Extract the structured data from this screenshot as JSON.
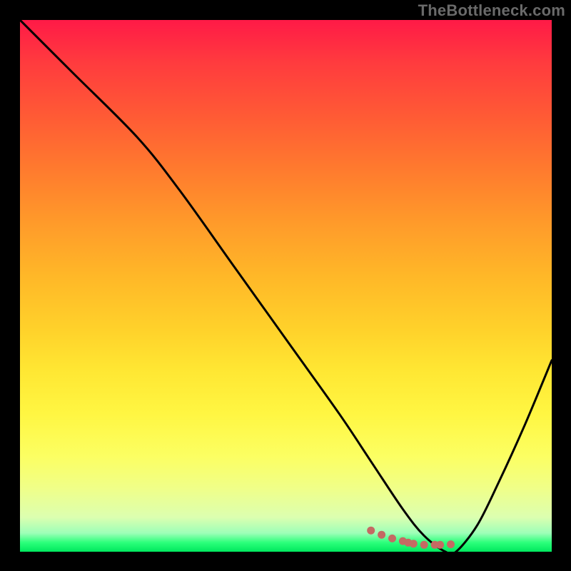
{
  "watermark": "TheBottleneck.com",
  "colors": {
    "curve_stroke": "#000000",
    "dotted_stroke": "#c46a63",
    "background": "#000000"
  },
  "chart_data": {
    "type": "line",
    "title": "",
    "xlabel": "",
    "ylabel": "",
    "xlim": [
      0,
      100
    ],
    "ylim": [
      0,
      100
    ],
    "series": [
      {
        "name": "bottleneck-curve",
        "x": [
          0,
          10,
          22,
          30,
          40,
          50,
          60,
          66,
          72,
          76,
          80,
          82,
          86,
          90,
          95,
          100
        ],
        "values": [
          100,
          90,
          78,
          68,
          54,
          40,
          26,
          17,
          8,
          3,
          0,
          0,
          5,
          13,
          24,
          36
        ]
      }
    ],
    "dotted_segment": {
      "name": "highlight-dots",
      "x": [
        66,
        68,
        70,
        72,
        73,
        74,
        76,
        78,
        79,
        81
      ],
      "values": [
        4,
        3.2,
        2.5,
        2.0,
        1.7,
        1.5,
        1.3,
        1.3,
        1.3,
        1.4
      ]
    },
    "gradient_stops": [
      {
        "pct": 0,
        "color": "#ff1a47"
      },
      {
        "pct": 18,
        "color": "#ff5a35"
      },
      {
        "pct": 38,
        "color": "#ff9a2a"
      },
      {
        "pct": 58,
        "color": "#ffd12a"
      },
      {
        "pct": 74,
        "color": "#fff642"
      },
      {
        "pct": 88,
        "color": "#f0ff88"
      },
      {
        "pct": 96.5,
        "color": "#9dffb8"
      },
      {
        "pct": 100,
        "color": "#00e85e"
      }
    ]
  }
}
